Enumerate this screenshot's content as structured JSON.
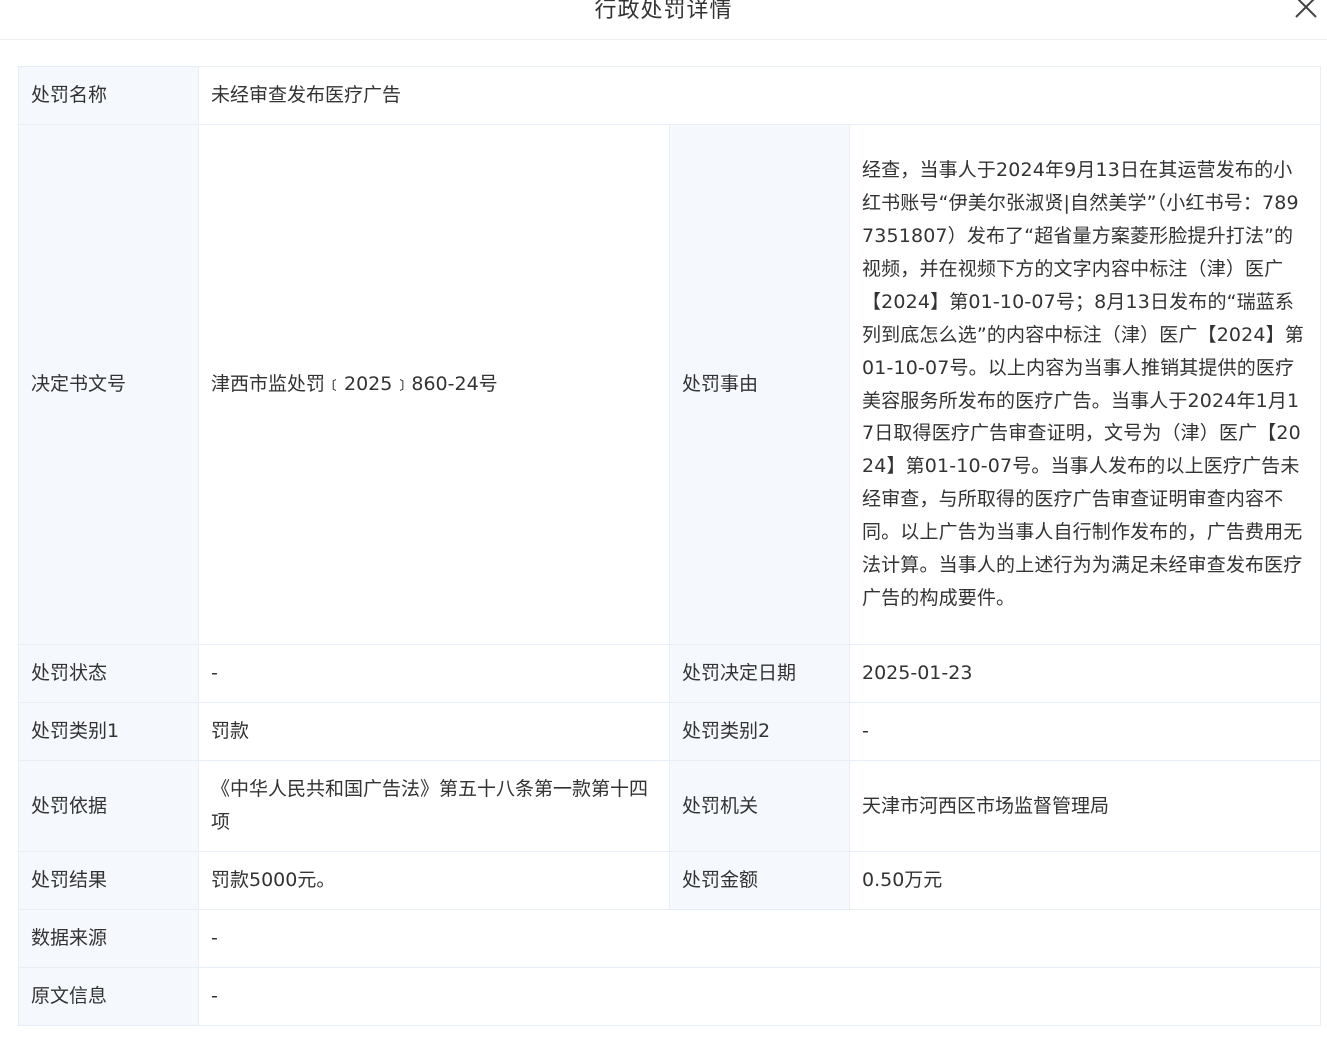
{
  "header": {
    "title": "行政处罚详情",
    "close_icon": "close-icon"
  },
  "fields": {
    "penalty_name": {
      "label": "处罚名称",
      "value": "未经审查发布医疗广告"
    },
    "decision_no": {
      "label": "决定书文号",
      "value": "津西市监处罚﹝2025﹞860-24号"
    },
    "reason": {
      "label": "处罚事由",
      "value": "经查，当事人于2024年9月13日在其运营发布的小红书账号“伊美尔张淑贤|自然美学”（小红书号：7897351807）发布了“超省量方案菱形脸提升打法”的视频，并在视频下方的文字内容中标注（津）医广【2024】第01-10-07号；8月13日发布的“瑞蓝系列到底怎么选”的内容中标注（津）医广【2024】第01-10-07号。以上内容为当事人推销其提供的医疗美容服务所发布的医疗广告。当事人于2024年1月17日取得医疗广告审查证明，文号为（津）医广【2024】第01-10-07号。当事人发布的以上医疗广告未经审查，与所取得的医疗广告审查证明审查内容不同。以上广告为当事人自行制作发布的，广告费用无法计算。当事人的上述行为为满足未经审查发布医疗广告的构成要件。"
    },
    "status": {
      "label": "处罚状态",
      "value": "-"
    },
    "decision_date": {
      "label": "处罚决定日期",
      "value": "2025-01-23"
    },
    "category1": {
      "label": "处罚类别1",
      "value": "罚款"
    },
    "category2": {
      "label": "处罚类别2",
      "value": "-"
    },
    "basis": {
      "label": "处罚依据",
      "value": "《中华人民共和国广告法》第五十八条第一款第十四项"
    },
    "authority": {
      "label": "处罚机关",
      "value": "天津市河西区市场监督管理局"
    },
    "result": {
      "label": "处罚结果",
      "value": "罚款5000元。"
    },
    "amount": {
      "label": "处罚金额",
      "value": "0.50万元"
    },
    "source": {
      "label": "数据来源",
      "value": "-"
    },
    "original": {
      "label": "原文信息",
      "value": "-"
    }
  },
  "colors": {
    "label_bg": "#f5f8fd",
    "border": "#e8eef5",
    "text": "#333333"
  }
}
